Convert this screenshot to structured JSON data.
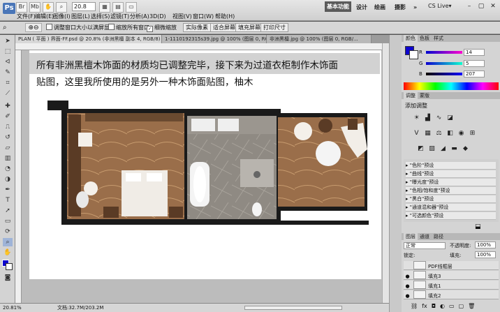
{
  "app": {
    "logo": "Ps",
    "zoom_select": "20.8",
    "cslive": "CS Live▾"
  },
  "menu": [
    "文件(F)",
    "编辑(E)",
    "图像(I)",
    "图层(L)",
    "选择(S)",
    "滤镜(T)",
    "分析(A)",
    "3D(D)",
    "视图(V)",
    "窗口(W)",
    "帮助(H)"
  ],
  "workspaces": {
    "active": "基本功能",
    "others": [
      "设计",
      "绘画",
      "摄影"
    ],
    "more": "»"
  },
  "window_controls": {
    "minimize": "–",
    "restore": "▢",
    "close": "✕"
  },
  "options": {
    "resize": "调整窗口大小以满屏显示",
    "zoom_all": "缩放所有窗口",
    "scrubby": "细微缩放",
    "actual": "实际像素",
    "fit": "适合屏幕",
    "fill": "填充屏幕",
    "print": "打印尺寸"
  },
  "tabs": [
    {
      "label": "PLAN ( 平面 ) 界面-FF.psd @ 20.8% (非洲黑檀 副本 4, RGB/8) *",
      "close": "×"
    },
    {
      "label": "1-1110192315s39.jpg @ 100% (图层 0, RGB/...",
      "close": "×"
    },
    {
      "label": "非洲黑檀.jpg @ 100% (图层 0, RGB/...",
      "close": "×"
    }
  ],
  "caption": {
    "line1": "所有非洲黑檀木饰面的材质均已调整完毕，接下来为过道衣柜制作木饰面",
    "line2": "贴图，这里我所使用的是另外一种木饰面贴图，柚木"
  },
  "status": {
    "zoom": "20.81%",
    "doc": "文档:32.7M/203.2M"
  },
  "panels": {
    "color_tabs": [
      "颜色",
      "色板",
      "样式"
    ],
    "color": {
      "r_label": "R",
      "g_label": "G",
      "b_label": "B",
      "r": "14",
      "g": "5",
      "b": "207",
      "fg": "#0e05cf"
    },
    "adjust_tabs": [
      "调整",
      "蒙版"
    ],
    "adjust_title": "添加调整",
    "presets": [
      "\"色阶\"预设",
      "\"曲线\"预设",
      "\"曝光度\"预设",
      "\"色相/饱和度\"预设",
      "\"黑白\"预设",
      "\"通道混和器\"预设",
      "\"可选颜色\"预设"
    ],
    "layers_tabs": [
      "图层",
      "通道",
      "路径"
    ],
    "blend": "正常",
    "opacity_label": "不透明度:",
    "opacity": "100%",
    "lock_label": "锁定:",
    "fill_label": "填充:",
    "fill": "100%",
    "layers": [
      "PDF线框层",
      "填充3",
      "填充1",
      "填充2"
    ]
  }
}
